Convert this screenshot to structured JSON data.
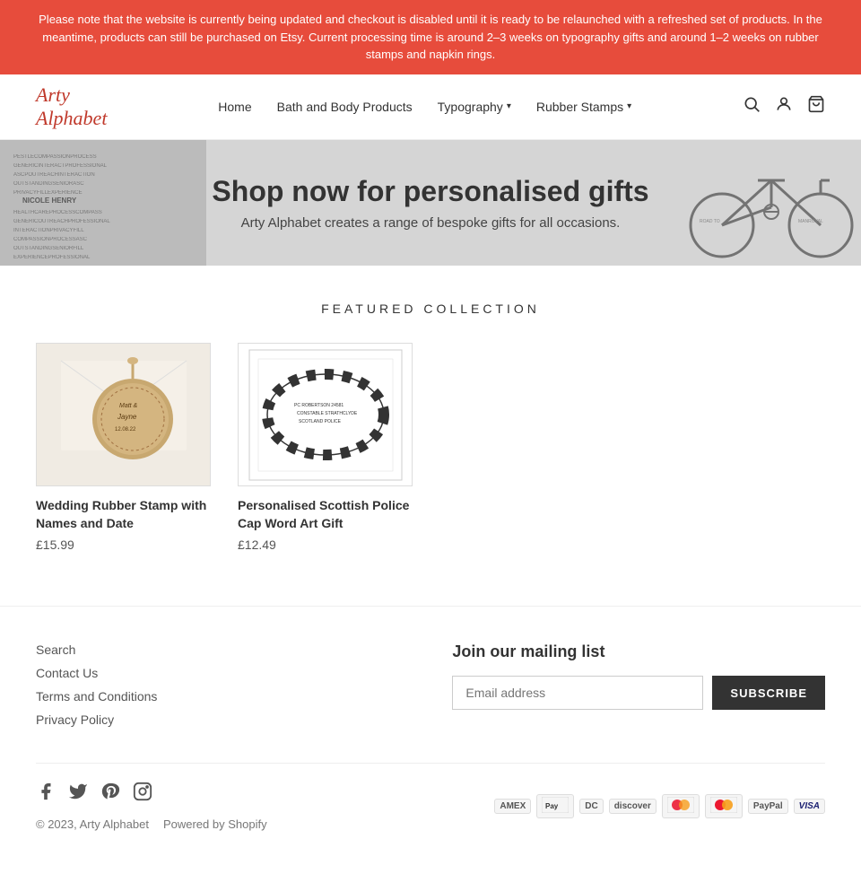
{
  "announcement": {
    "text": "Please note that the website is currently being updated and checkout is disabled until it is ready to be relaunched with a refreshed set of products. In the meantime, products can still be purchased on Etsy. Current processing time is around 2–3 weeks on typography gifts and around 1–2 weeks on rubber stamps and napkin rings."
  },
  "header": {
    "logo_line1": "Arty",
    "logo_line2": "Alphabet",
    "nav": {
      "home": "Home",
      "bath": "Bath and Body Products",
      "typography": "Typography",
      "typography_arrow": "▾",
      "rubber_stamps": "Rubber Stamps",
      "rubber_stamps_arrow": "▾"
    },
    "search_label": "Search",
    "log_in_label": "Log in",
    "cart_label": "Cart"
  },
  "hero": {
    "heading": "Shop now for personalised gifts",
    "subtext": "Arty Alphabet creates a range of bespoke gifts for all occasions."
  },
  "featured": {
    "section_title": "FEATURED COLLECTION",
    "products": [
      {
        "title": "Wedding Rubber Stamp with Names and Date",
        "price": "£15.99",
        "image_alt": "Wedding rubber stamp wooden circular ornament"
      },
      {
        "title": "Personalised Scottish Police Cap Word Art Gift",
        "price": "£12.49",
        "image_alt": "Scottish police cap word art oval print framed"
      }
    ]
  },
  "footer": {
    "links": [
      {
        "label": "Search"
      },
      {
        "label": "Contact Us"
      },
      {
        "label": "Terms and Conditions"
      },
      {
        "label": "Privacy Policy"
      }
    ],
    "newsletter": {
      "heading": "Join our mailing list",
      "input_placeholder": "Email address",
      "button_label": "SUBSCRIBE"
    },
    "social": {
      "facebook": "f",
      "twitter": "𝕏",
      "pinterest": "P",
      "instagram": "◻"
    },
    "copyright": "© 2023, Arty Alphabet",
    "powered_by": "Powered by Shopify",
    "payment_methods": [
      "AMEX",
      "Pay",
      "DINERS",
      "discover",
      "master",
      "master",
      "PayPal",
      "VISA"
    ]
  }
}
